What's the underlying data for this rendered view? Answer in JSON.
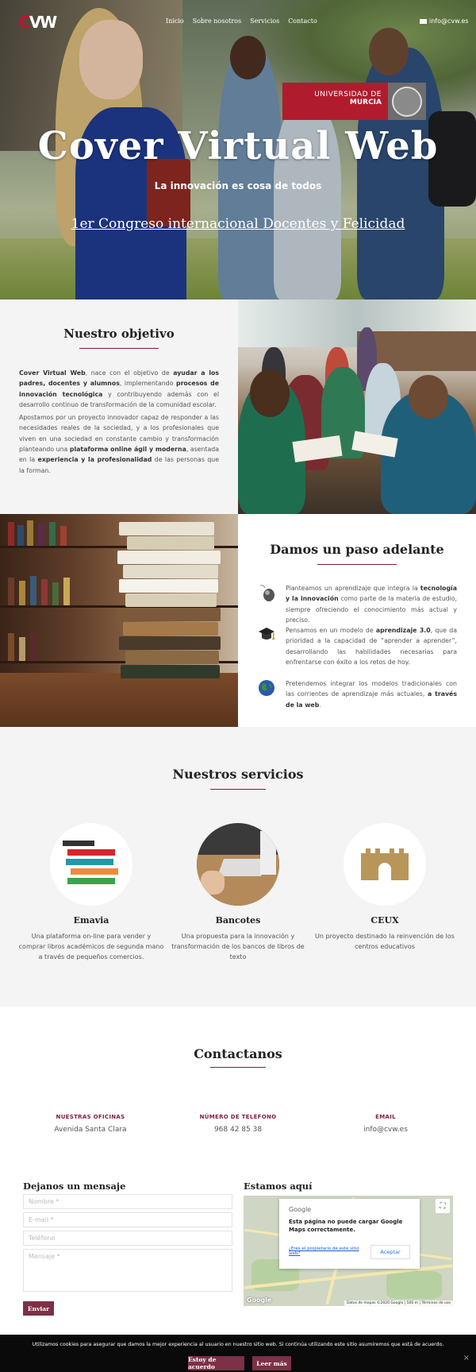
{
  "brand": {
    "logo_text": "CVW",
    "colors": {
      "accent": "#7d3046",
      "rule": "#7d1f3a",
      "umu_red": "#b01c2e"
    }
  },
  "nav": {
    "items": [
      "Inicio",
      "Sobre nosotros",
      "Servicios",
      "Contacto"
    ],
    "email": "info@cvw.es"
  },
  "hero": {
    "university_line1": "UNIVERSIDAD DE",
    "university_line2": "MURCIA",
    "title": "Cover Virtual Web",
    "subtitle": "La innovación es cosa de todos",
    "link": "1er Congreso internacional Docentes y Felicidad"
  },
  "objective": {
    "title": "Nuestro objetivo",
    "p1": [
      {
        "t": "Cover Virtual Web",
        "b": true
      },
      {
        "t": ", nace con el objetivo de ",
        "b": false
      },
      {
        "t": "ayudar a los padres, docentes y alumnos",
        "b": true
      },
      {
        "t": ", implementando ",
        "b": false
      },
      {
        "t": "procesos de innovación tecnológica",
        "b": true
      },
      {
        "t": " y contribuyendo además con el desarrollo continuo de transformación de la comunidad escolar.",
        "b": false
      }
    ],
    "p2": [
      {
        "t": "Apostamos por un proyecto innovador capaz de responder a las necesidades reales de la sociedad, y a los profesionales que viven en una sociedad en constante cambio y transformación planteando una ",
        "b": false
      },
      {
        "t": "plataforma online ágil y moderna",
        "b": true
      },
      {
        "t": ", asentada en la ",
        "b": false
      },
      {
        "t": "experiencia y la profesionalidad",
        "b": true
      },
      {
        "t": " de las personas que la forman.",
        "b": false
      }
    ]
  },
  "step": {
    "title": "Damos un paso adelante",
    "features": [
      {
        "icon": "mouse-icon",
        "parts": [
          {
            "t": "Planteamos un aprendizaje que integra la ",
            "b": false
          },
          {
            "t": "tecnología y la innovación",
            "b": true
          },
          {
            "t": " como parte de la materia de estudio, siempre ofreciendo el conocimiento más actual y preciso.",
            "b": false
          }
        ]
      },
      {
        "icon": "graduation-cap-icon",
        "parts": [
          {
            "t": "Pensamos en un modelo de ",
            "b": false
          },
          {
            "t": "aprendizaje 3.0",
            "b": true
          },
          {
            "t": ", que da prioridad a la capacidad de “aprender a aprender”, desarrollando las habilidades necesarias para enfrentarse con éxito a los retos de hoy.",
            "b": false
          }
        ]
      },
      {
        "icon": "globe-icon",
        "parts": [
          {
            "t": "Pretendemos integrar los modelos tradicionales con las corrientes de aprendizaje más actuales, ",
            "b": false
          },
          {
            "t": "a través de la web",
            "b": true
          },
          {
            "t": ".",
            "b": false
          }
        ]
      }
    ]
  },
  "services": {
    "title": "Nuestros servicios",
    "items": [
      {
        "name": "Emavia",
        "desc": "Una plataforma on-line para vender y comprar libros académicos de segunda mano a través de pequeños comercios."
      },
      {
        "name": "Bancotes",
        "desc": "Una propuesta para la innovación y transformación de los bancos de libros de texto"
      },
      {
        "name": "CEUX",
        "desc": "Un proyecto destinado la reinvención de los centros educativos"
      }
    ]
  },
  "contact": {
    "title": "Contactanos",
    "info": [
      {
        "label": "NUESTRAS OFICINAS",
        "value": "Avenida Santa Clara"
      },
      {
        "label": "NÚMERO DE TELÉFONO",
        "value": "968 42 85 38"
      },
      {
        "label": "EMAIL",
        "value": "info@cvw.es"
      }
    ],
    "form_title": "Dejanos un mensaje",
    "placeholders": {
      "name": "Nombre *",
      "email": "E-mail *",
      "phone": "Teléfono",
      "message": "Mensaje *"
    },
    "send": "Enviar",
    "map_title": "Estamos aquí",
    "map": {
      "brand": "Google",
      "error": "Esta página no puede cargar Google Maps correctamente.",
      "owner_q": "¿Eres el propietario de este sitio web?",
      "accept": "Aceptar",
      "logo": "Google",
      "credits": "Datos de mapas ©2020 Google | 500 m | Términos de uso"
    }
  },
  "cookie": {
    "text": "Utilizamos cookies para asegurar que damos la mejor experiencia al usuario en nuestro sitio web. Si continúa utilizando este sitio asumiremos que está de acuerdo.",
    "agree": "Estoy de acuerdo",
    "more": "Leer más",
    "close": "×"
  }
}
